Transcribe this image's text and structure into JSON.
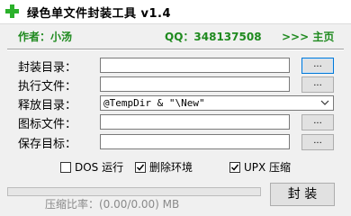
{
  "window": {
    "title": "绿色单文件封装工具 v1.4"
  },
  "info": {
    "author": "作者：小汤",
    "qq": "QQ：348137508",
    "homepage": ">>> 主页"
  },
  "form": {
    "package_dir_label": "封装目录：",
    "exec_file_label": "执行文件：",
    "release_dir_label": "释放目录：",
    "release_dir_value": "@TempDir & \"\\New\"",
    "icon_file_label": "图标文件：",
    "save_target_label": "保存目标：",
    "browse_label": "..."
  },
  "options": {
    "dos_run": {
      "label": "DOS 运行",
      "checked": false
    },
    "delete_env": {
      "label": "删除环境",
      "checked": true
    },
    "upx": {
      "label": "UPX 压缩",
      "checked": true
    }
  },
  "status": {
    "progress": 0,
    "compression_ratio": "压缩比率：(0.00/0.00) MB"
  },
  "actions": {
    "pack_label": "封 装"
  },
  "colors": {
    "accent_green": "#1f8a1f",
    "progress_green": "#06b025"
  }
}
